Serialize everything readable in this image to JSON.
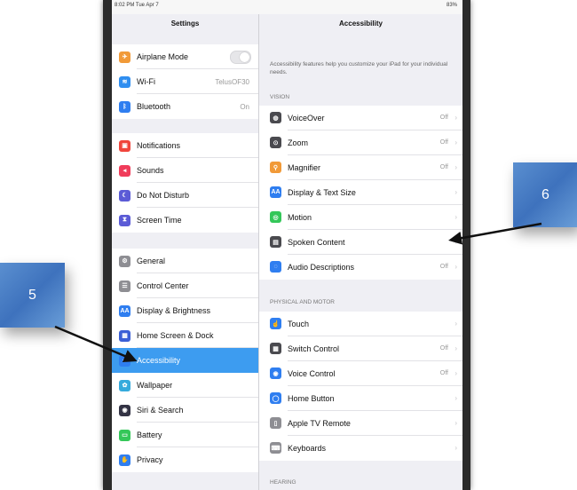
{
  "status": {
    "time": "8:02 PM  Tue Apr 7",
    "battery": "83%"
  },
  "left": {
    "title": "Settings",
    "groups": [
      [
        {
          "label": "Airplane Mode",
          "value": "",
          "color": "#f19a38",
          "icon": "airplane-icon",
          "glyph": "✈",
          "toggle": true
        },
        {
          "label": "Wi-Fi",
          "value": "TelusOF30",
          "color": "#2f8ef0",
          "icon": "wifi-icon",
          "glyph": "≋"
        },
        {
          "label": "Bluetooth",
          "value": "On",
          "color": "#2f7ef0",
          "icon": "bluetooth-icon",
          "glyph": "ᛒ"
        }
      ],
      [
        {
          "label": "Notifications",
          "value": "",
          "color": "#f0453c",
          "icon": "notifications-icon",
          "glyph": "▣"
        },
        {
          "label": "Sounds",
          "value": "",
          "color": "#f03c5a",
          "icon": "sounds-icon",
          "glyph": "◂"
        },
        {
          "label": "Do Not Disturb",
          "value": "",
          "color": "#5b5bd6",
          "icon": "moon-icon",
          "glyph": "☾"
        },
        {
          "label": "Screen Time",
          "value": "",
          "color": "#5b5bd6",
          "icon": "hourglass-icon",
          "glyph": "⧗"
        }
      ],
      [
        {
          "label": "General",
          "value": "",
          "color": "#8e8e93",
          "icon": "gear-icon",
          "glyph": "⚙"
        },
        {
          "label": "Control Center",
          "value": "",
          "color": "#8e8e93",
          "icon": "control-center-icon",
          "glyph": "☰"
        },
        {
          "label": "Display & Brightness",
          "value": "",
          "color": "#2f7ef0",
          "icon": "display-icon",
          "glyph": "AA"
        },
        {
          "label": "Home Screen & Dock",
          "value": "",
          "color": "#3b5fd6",
          "icon": "home-screen-icon",
          "glyph": "▦"
        },
        {
          "label": "Accessibility",
          "value": "",
          "color": "#2f7ef0",
          "icon": "accessibility-icon",
          "glyph": "☺",
          "selected": true
        },
        {
          "label": "Wallpaper",
          "value": "",
          "color": "#35aadc",
          "icon": "wallpaper-icon",
          "glyph": "✿"
        },
        {
          "label": "Siri & Search",
          "value": "",
          "color": "#333344",
          "icon": "siri-icon",
          "glyph": "◉"
        },
        {
          "label": "Battery",
          "value": "",
          "color": "#34c759",
          "icon": "battery-icon",
          "glyph": "▭"
        },
        {
          "label": "Privacy",
          "value": "",
          "color": "#2f7ef0",
          "icon": "hand-icon",
          "glyph": "✋"
        }
      ]
    ]
  },
  "right": {
    "title": "Accessibility",
    "description": "Accessibility features help you customize your iPad for your individual needs.",
    "sections": [
      {
        "header": "VISION",
        "items": [
          {
            "label": "VoiceOver",
            "value": "Off",
            "color": "#4a4a4f",
            "icon": "voiceover-icon",
            "glyph": "◍"
          },
          {
            "label": "Zoom",
            "value": "Off",
            "color": "#4a4a4f",
            "icon": "zoom-icon",
            "glyph": "⊙"
          },
          {
            "label": "Magnifier",
            "value": "Off",
            "color": "#f19a38",
            "icon": "magnifier-icon",
            "glyph": "⚲"
          },
          {
            "label": "Display & Text Size",
            "value": "",
            "color": "#2f7ef0",
            "icon": "text-size-icon",
            "glyph": "AA"
          },
          {
            "label": "Motion",
            "value": "",
            "color": "#34c759",
            "icon": "motion-icon",
            "glyph": "◎"
          },
          {
            "label": "Spoken Content",
            "value": "",
            "color": "#4a4a4f",
            "icon": "spoken-content-icon",
            "glyph": "▤"
          },
          {
            "label": "Audio Descriptions",
            "value": "Off",
            "color": "#2f7ef0",
            "icon": "audio-descriptions-icon",
            "glyph": "◌"
          }
        ]
      },
      {
        "header": "PHYSICAL AND MOTOR",
        "items": [
          {
            "label": "Touch",
            "value": "",
            "color": "#2f7ef0",
            "icon": "touch-icon",
            "glyph": "☝"
          },
          {
            "label": "Switch Control",
            "value": "Off",
            "color": "#4a4a4f",
            "icon": "switch-control-icon",
            "glyph": "▦"
          },
          {
            "label": "Voice Control",
            "value": "Off",
            "color": "#2f7ef0",
            "icon": "voice-control-icon",
            "glyph": "◉"
          },
          {
            "label": "Home Button",
            "value": "",
            "color": "#2f7ef0",
            "icon": "home-button-icon",
            "glyph": "◯"
          },
          {
            "label": "Apple TV Remote",
            "value": "",
            "color": "#8e8e93",
            "icon": "remote-icon",
            "glyph": "▯"
          },
          {
            "label": "Keyboards",
            "value": "",
            "color": "#8e8e93",
            "icon": "keyboard-icon",
            "glyph": "⌨"
          }
        ]
      },
      {
        "header": "HEARING",
        "items": []
      }
    ]
  },
  "callouts": {
    "left": "5",
    "right": "6"
  }
}
